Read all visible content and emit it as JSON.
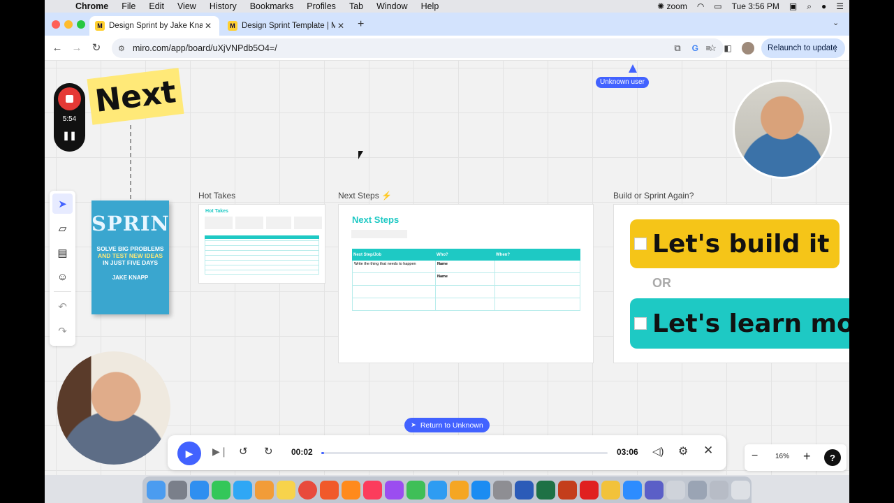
{
  "menubar": {
    "app": "Chrome",
    "items": [
      "File",
      "Edit",
      "View",
      "History",
      "Bookmarks",
      "Profiles",
      "Tab",
      "Window",
      "Help"
    ],
    "zoom_label": "zoom",
    "clock": "Tue 3:56 PM"
  },
  "tabs": [
    {
      "label": "Design Sprint by Jake Knapp",
      "close": "✕"
    },
    {
      "label": "Design Sprint Template | Miro",
      "close": "✕"
    }
  ],
  "new_tab": "+",
  "url": "miro.com/app/board/uXjVNPdb5O4=/",
  "relaunch": "Relaunch to update",
  "unknown_user": "Unknown user",
  "recorder": {
    "time": "5:54"
  },
  "next_sticker": "Next",
  "book": {
    "title": "SPRINT",
    "line1": "SOLVE BIG PROBLEMS",
    "line2": "AND TEST NEW IDEAS",
    "line3": "IN JUST FIVE DAYS",
    "author": "JAKE KNAPP"
  },
  "frames": {
    "hot_takes": {
      "label": "Hot Takes",
      "title": "Hot Takes"
    },
    "next_steps": {
      "label": "Next Steps ⚡",
      "title": "Next Steps",
      "table": {
        "headers": [
          "Next Step/Job",
          "Who?",
          "When?"
        ],
        "rows": [
          [
            "Write the thing that needs to happen",
            "Name",
            ""
          ],
          [
            "",
            "Name",
            ""
          ],
          [
            "",
            "",
            ""
          ],
          [
            "",
            "",
            ""
          ]
        ]
      }
    },
    "build_or_sprint": {
      "label": "Build or Sprint Again?",
      "option1": "Let's build it",
      "or": "OR",
      "option2": "Let's learn mo"
    }
  },
  "return_button": "Return to Unknown",
  "player": {
    "current": "00:02",
    "total": "03:06",
    "progress": 0.01
  },
  "zoom": {
    "level": "16%",
    "minus": "−",
    "plus": "+",
    "help": "?"
  },
  "colors": {
    "miro_blue": "#4262ff",
    "sticker_yellow": "#ffe978",
    "build_yellow": "#f5c518",
    "learn_teal": "#1ec9c4",
    "rec_red": "#e53935"
  }
}
